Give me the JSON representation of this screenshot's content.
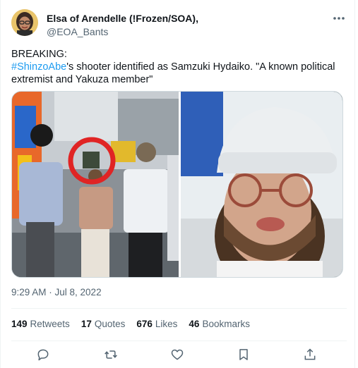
{
  "author": {
    "display_name": "Elsa of Arendelle (!Frozen/SOA),",
    "handle": "@EOA_Bants"
  },
  "tweet": {
    "line1": "BREAKING:",
    "hashtag": "#ShinzoAbe",
    "text_after_hashtag": "'s shooter identified as Samzuki Hydaiko. \"A known political extremist and Yakuza member\""
  },
  "timestamp": "9:29 AM · Jul 8, 2022",
  "stats": {
    "retweets_count": "149",
    "retweets_label": "Retweets",
    "quotes_count": "17",
    "quotes_label": "Quotes",
    "likes_count": "676",
    "likes_label": "Likes",
    "bookmarks_count": "46",
    "bookmarks_label": "Bookmarks"
  },
  "colors": {
    "link": "#1d9bf0",
    "secondary_text": "#536471",
    "divider": "#eff3f4"
  },
  "icons": {
    "more": "more-icon",
    "reply": "reply-icon",
    "retweet": "retweet-icon",
    "like": "heart-icon",
    "bookmark": "bookmark-icon",
    "share": "share-icon"
  }
}
